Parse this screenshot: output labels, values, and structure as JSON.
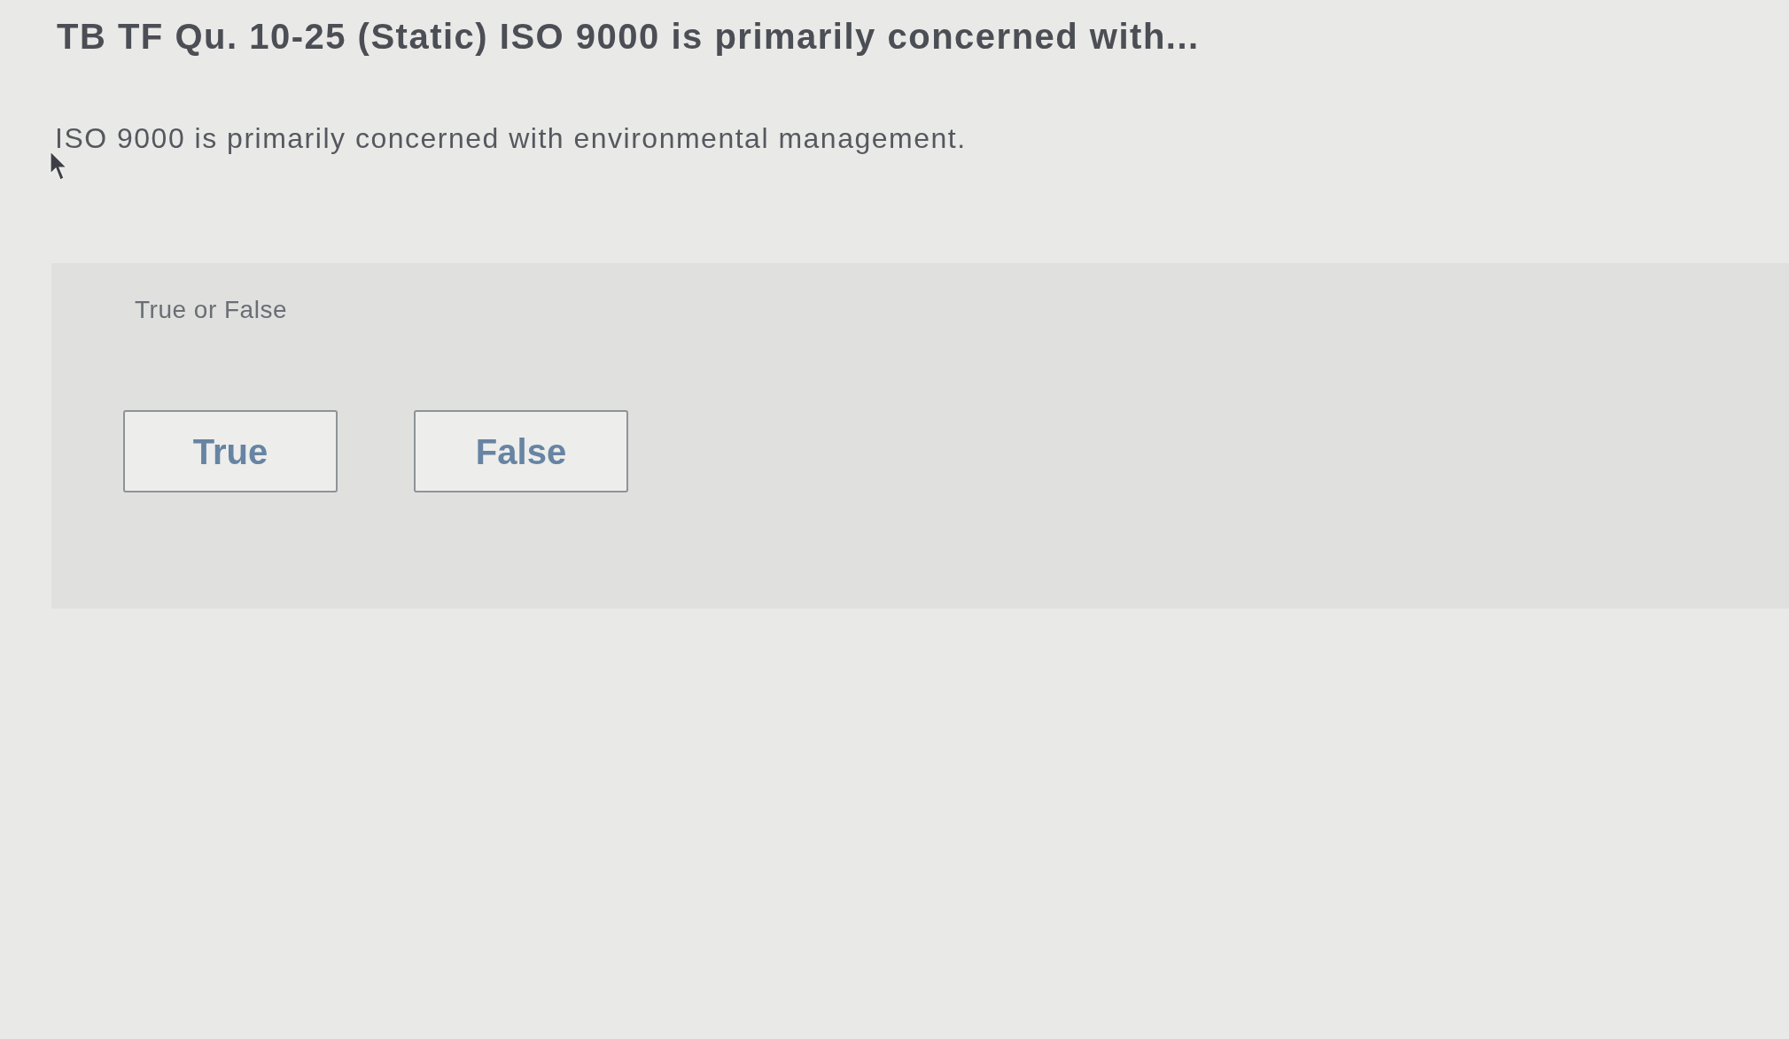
{
  "title": "TB TF Qu. 10-25 (Static) ISO 9000 is primarily concerned with...",
  "question": "ISO 9000 is primarily concerned with environmental management.",
  "answer_panel": {
    "prompt": "True or False",
    "options": [
      {
        "label": "True",
        "selected": false
      },
      {
        "label": "False",
        "selected": false
      }
    ]
  }
}
